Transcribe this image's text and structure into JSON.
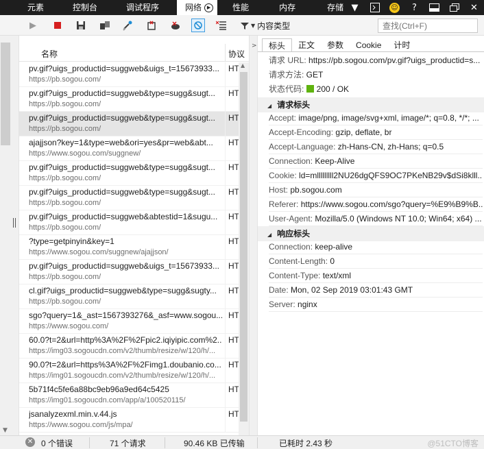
{
  "top_tabs": [
    {
      "label": "元素"
    },
    {
      "label": "控制台"
    },
    {
      "label": "调试程序"
    },
    {
      "label": "网络"
    },
    {
      "label": "性能"
    },
    {
      "label": "内存"
    },
    {
      "label": "存储"
    }
  ],
  "toolbar": {
    "content_type_label": "内容类型",
    "search_placeholder": "查找(Ctrl+F)"
  },
  "list": {
    "col_name": "名称",
    "col_protocol": "协议",
    "rows": [
      {
        "name": "pv.gif?uigs_productid=suggweb&uigs_t=15673933...",
        "url": "https://pb.sogou.com/",
        "proto": "HT"
      },
      {
        "name": "pv.gif?uigs_productid=suggweb&type=sugg&sugt...",
        "url": "https://pb.sogou.com/",
        "proto": "HT"
      },
      {
        "name": "pv.gif?uigs_productid=suggweb&type=sugg&sugt...",
        "url": "https://pb.sogou.com/",
        "proto": "HT"
      },
      {
        "name": "ajajjson?key=1&type=web&ori=yes&pr=web&abt...",
        "url": "https://www.sogou.com/suggnew/",
        "proto": "HT"
      },
      {
        "name": "pv.gif?uigs_productid=suggweb&type=sugg&sugt...",
        "url": "https://pb.sogou.com/",
        "proto": "HT"
      },
      {
        "name": "pv.gif?uigs_productid=suggweb&type=sugg&sugt...",
        "url": "https://pb.sogou.com/",
        "proto": "HT"
      },
      {
        "name": "pv.gif?uigs_productid=suggweb&abtestid=1&sugu...",
        "url": "https://pb.sogou.com/",
        "proto": "HT"
      },
      {
        "name": "?type=getpinyin&key=1",
        "url": "https://www.sogou.com/suggnew/ajajjson/",
        "proto": "HT"
      },
      {
        "name": "pv.gif?uigs_productid=suggweb&uigs_t=15673933...",
        "url": "https://pb.sogou.com/",
        "proto": "HT"
      },
      {
        "name": "cl.gif?uigs_productid=suggweb&type=sugg&sugty...",
        "url": "https://pb.sogou.com/",
        "proto": "HT"
      },
      {
        "name": "sgo?query=1&_ast=1567393276&_asf=www.sogou...",
        "url": "https://www.sogou.com/",
        "proto": "HT"
      },
      {
        "name": "60.0?t=2&url=http%3A%2F%2Fpic2.iqiyipic.com%2...",
        "url": "https://img03.sogoucdn.com/v2/thumb/resize/w/120/h/...",
        "proto": "HT"
      },
      {
        "name": "90.0?t=2&url=https%3A%2F%2Fimg1.doubanio.co...",
        "url": "https://img01.sogoucdn.com/v2/thumb/resize/w/120/h/...",
        "proto": "HT"
      },
      {
        "name": "5b71f4c5fe6a88bc9eb96a9ed64c5425",
        "url": "https://img01.sogoucdn.com/app/a/100520115/",
        "proto": "HT"
      },
      {
        "name": "jsanalyzexml.min.v.44.js",
        "url": "https://www.sogou.com/js/mpa/",
        "proto": "HT"
      }
    ]
  },
  "detail": {
    "tabs": [
      {
        "label": "标头"
      },
      {
        "label": "正文"
      },
      {
        "label": "参数"
      },
      {
        "label": "Cookie"
      },
      {
        "label": "计时"
      }
    ],
    "summary": {
      "url_key": "请求 URL: ",
      "url_val": "https://pb.sogou.com/pv.gif?uigs_productid=s...",
      "method_key": "请求方法: ",
      "method_val": "GET",
      "status_key": "状态代码: ",
      "status_val": "200 / OK"
    },
    "request_section": "请求标头",
    "request_headers": [
      {
        "k": "Accept: ",
        "v": "image/png, image/svg+xml, image/*; q=0.8, */*; ..."
      },
      {
        "k": "Accept-Encoding: ",
        "v": "gzip, deflate, br"
      },
      {
        "k": "Accept-Language: ",
        "v": "zh-Hans-CN, zh-Hans; q=0.5"
      },
      {
        "k": "Connection: ",
        "v": "Keep-Alive"
      },
      {
        "k": "Cookie: ",
        "v": "ld=mlllllllll2NU26dgQFS9OC7PKeNB29v$dSi8klll..."
      },
      {
        "k": "Host: ",
        "v": "pb.sogou.com"
      },
      {
        "k": "Referer: ",
        "v": "https://www.sogou.com/sgo?query=%E9%B9%B..."
      },
      {
        "k": "User-Agent: ",
        "v": "Mozilla/5.0 (Windows NT 10.0; Win64; x64) ..."
      }
    ],
    "response_section": "响应标头",
    "response_headers": [
      {
        "k": "Connection: ",
        "v": "keep-alive"
      },
      {
        "k": "Content-Length: ",
        "v": "0"
      },
      {
        "k": "Content-Type: ",
        "v": "text/xml"
      },
      {
        "k": "Date: ",
        "v": "Mon, 02 Sep 2019 03:01:43 GMT"
      },
      {
        "k": "Server: ",
        "v": "nginx"
      }
    ]
  },
  "status_bar": {
    "errors": "0 个错误",
    "requests": "71 个请求",
    "transferred": "90.46 KB 已传输",
    "elapsed": "已耗时 2.43 秒",
    "watermark": "@51CTO博客"
  },
  "colors": {
    "topbar_bg": "#1e1e1e",
    "status_ok": "#5fb30f",
    "selected_row": "#e5e5e5"
  }
}
